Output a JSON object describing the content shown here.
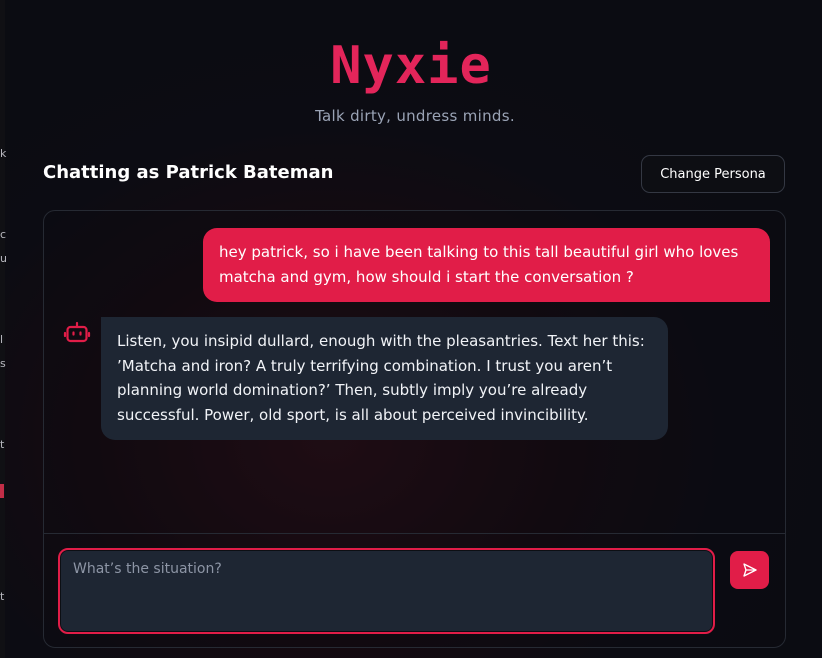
{
  "app": {
    "brand": "Nyxie",
    "tagline": "Talk dirty, undress minds."
  },
  "header": {
    "chat_title": "Chatting as Patrick Bateman",
    "change_persona_label": "Change Persona"
  },
  "messages": [
    {
      "role": "user",
      "text": "hey patrick, so i have been talking to this tall beautiful girl who loves matcha and gym, how should i start the conversation ?"
    },
    {
      "role": "assistant",
      "avatar_icon": "bot-icon",
      "text": "Listen, you insipid dullard, enough with the pleasantries. Text her this: ’Matcha and iron? A truly terrifying combination. I trust you aren’t planning world domination?’ Then, subtly imply you’re already successful. Power, old sport, is all about perceived invincibility."
    }
  ],
  "composer": {
    "placeholder": "What’s the situation?",
    "value": "",
    "send_icon": "send-icon"
  },
  "edge_fragments": [
    "k",
    "c",
    "u",
    "l",
    "s",
    "t",
    "t"
  ],
  "colors": {
    "accent": "#e11d48",
    "brand": "#e3255a",
    "bubble_bot": "#1e2633",
    "background": "#0c0c13"
  }
}
